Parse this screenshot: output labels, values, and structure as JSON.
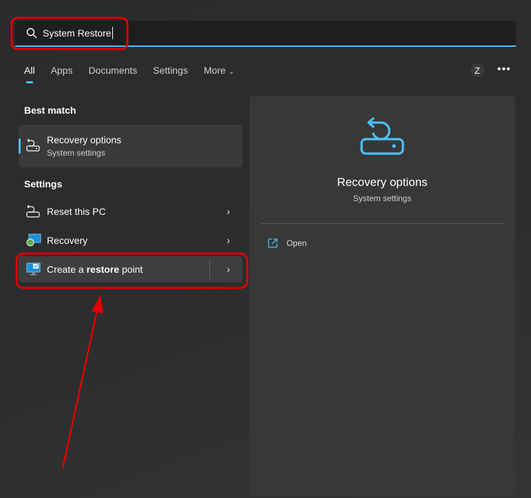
{
  "search": {
    "value": "System Restore",
    "icon": "search-icon"
  },
  "tabs": [
    {
      "label": "All"
    },
    {
      "label": "Apps"
    },
    {
      "label": "Documents"
    },
    {
      "label": "Settings"
    },
    {
      "label": "More"
    }
  ],
  "account_initial": "Z",
  "more_options": "•••",
  "best_match": {
    "heading": "Best match",
    "title": "Recovery options",
    "subtitle": "System settings"
  },
  "settings": {
    "heading": "Settings",
    "items": [
      {
        "label": "Reset this PC"
      },
      {
        "label_pre": "Create a ",
        "label_bold": "restore",
        "label_post": " point"
      },
      {
        "label": "Recovery"
      }
    ]
  },
  "preview": {
    "title": "Recovery options",
    "subtitle": "System settings",
    "open_label": "Open"
  },
  "colors": {
    "accent": "#4cc2ff",
    "annotation": "#e00000"
  }
}
